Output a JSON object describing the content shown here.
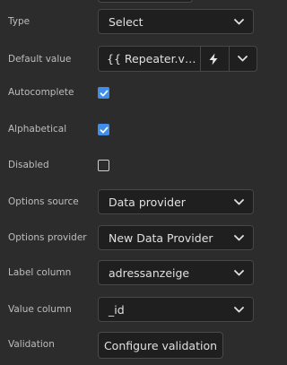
{
  "fields": {
    "type": {
      "label": "Type",
      "value": "Select"
    },
    "default_value": {
      "label": "Default value",
      "value": "{{ Repeater.ve…"
    },
    "autocomplete": {
      "label": "Autocomplete",
      "checked": true
    },
    "alphabetical": {
      "label": "Alphabetical",
      "checked": true
    },
    "disabled": {
      "label": "Disabled",
      "checked": false
    },
    "options_source": {
      "label": "Options source",
      "value": "Data provider"
    },
    "options_provider": {
      "label": "Options provider",
      "value": "New Data Provider"
    },
    "label_column": {
      "label": "Label column",
      "value": "adressanzeige"
    },
    "value_column": {
      "label": "Value column",
      "value": "_id"
    },
    "validation": {
      "label": "Validation",
      "button_label": "Configure validation"
    }
  },
  "icons": {
    "dropdown": "chevron-down-icon",
    "binding": "lightning-bolt-icon",
    "check": "checkmark-icon"
  },
  "colors": {
    "panel_background": "#2c2c2c",
    "control_background": "#1f1f1f",
    "checkbox_checked": "#3f8ee8"
  }
}
